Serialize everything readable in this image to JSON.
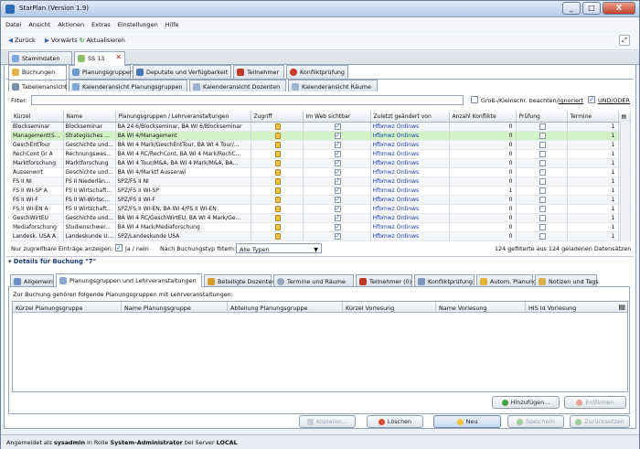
{
  "window": {
    "title": "StarPlan (Version 1.9)",
    "min": "_",
    "max": "□",
    "close": "X"
  },
  "menu": [
    "Datei",
    "Ansicht",
    "Aktionen",
    "Extras",
    "Einstellungen",
    "Hilfe"
  ],
  "nav": {
    "back": "Zurück",
    "forward": "Vorwärts",
    "refresh": "Aktualisieren"
  },
  "doc_tabs": [
    {
      "label": "Stammdaten"
    },
    {
      "label": "SS 13"
    }
  ],
  "main_tabs": [
    "Buchungen",
    "Planungsgruppen",
    "Deputate und Verfügbarkeit",
    "Teilnehmer",
    "Konfliktprüfung"
  ],
  "view_tabs": [
    "Tabellenansicht",
    "Kalenderansicht Planungsgruppen",
    "Kalenderansicht Dozenten",
    "Kalenderansicht Räume"
  ],
  "filter": {
    "label": "Filter:",
    "value": "",
    "case_label": "Groß-/Kleinschr. beachten",
    "ignore_label": "ignoriert",
    "andor_label": "UND/ODER"
  },
  "grid": {
    "columns": [
      "Kürzel",
      "Name",
      "Planungsgruppen / Lehrveranstaltungen",
      "Zugriff",
      "Im Web sichtbar",
      "Zuletzt geändert von",
      "Anzahl Konflikte",
      "Prüfung",
      "Termine"
    ],
    "rows": [
      {
        "k": "Blockseminar",
        "n": "Blockseminar",
        "pg": "BA 24 6/Blockseminar, BA WI 6/Blockseminar",
        "web": true,
        "by": "Hfbmwz Ordinws",
        "konf": "0",
        "pr": false,
        "t": "1"
      },
      {
        "k": "Management(S...",
        "n": "Strategisches ...",
        "pg": "BA WI 4/Management",
        "web": true,
        "by": "Hfbmwz Ordinws",
        "konf": "0",
        "pr": false,
        "t": "1"
      },
      {
        "k": "GeschEntTour",
        "n": "Geschichte und...",
        "pg": "BA WI 4 Mark/GeschEntTour, BA WI 4 Tour/...",
        "web": true,
        "by": "Hfbmwz Ordinws",
        "konf": "0",
        "pr": false,
        "t": "1"
      },
      {
        "k": "RechCont Gr A",
        "n": "Rechnungswes...",
        "pg": "BA WI 4 RC/RechCont, BA WI 4 Mark/RechC...",
        "web": true,
        "by": "Hfbmwz Ordinws",
        "konf": "0",
        "pr": false,
        "t": "1"
      },
      {
        "k": "Marktforschung",
        "n": "Marktforschung",
        "pg": "BA WI 4 Tour/M&A, BA WI 4 Mark/M&A, BA...",
        "web": true,
        "by": "Hfbmwz Ordinws",
        "konf": "0",
        "pr": false,
        "t": "1"
      },
      {
        "k": "Aussenwirt",
        "n": "Geschichte und...",
        "pg": "BA WI 4/Marktf Aussenwi",
        "web": true,
        "by": "Hfbmwz Ordinws",
        "konf": "0",
        "pr": false,
        "t": "1"
      },
      {
        "k": "FS II NI",
        "n": "FS II Niederlän...",
        "pg": "SPZ/FS II NI",
        "web": true,
        "by": "Hfbmwz Ordinws",
        "konf": "0",
        "pr": false,
        "t": "1"
      },
      {
        "k": "FS II WI-SP A",
        "n": "FS II Wirtschaft...",
        "pg": "SPZ/FS II WI-SP",
        "web": true,
        "by": "Hfbmwz Ordinws",
        "konf": "1",
        "pr": false,
        "t": "1"
      },
      {
        "k": "FS II WI-F",
        "n": "FS II WI-Wirtsc...",
        "pg": "SPZ/FS II WI-F",
        "web": true,
        "by": "Hfbmwz Ordinws",
        "konf": "0",
        "pr": false,
        "t": "1"
      },
      {
        "k": "FS II WI-EN A",
        "n": "FS II Wirtschaft...",
        "pg": "SPZ/FS II WI-EN, BA WI 4/FS II WI-EN",
        "web": true,
        "by": "Hfbmwz Ordinws",
        "konf": "0",
        "pr": false,
        "t": "1"
      },
      {
        "k": "GeschWirtEU",
        "n": "Geschichte und...",
        "pg": "BA WI 4 RC/GeschWirtEU, BA WI 4 Mark/Ge...",
        "web": true,
        "by": "Hfbmwz Ordinws",
        "konf": "0",
        "pr": false,
        "t": "1"
      },
      {
        "k": "Mediaforschung",
        "n": "Studienschwer...",
        "pg": "BA WI 4 Mark/Mediaforschung",
        "web": true,
        "by": "Hfbmwz Ordinws",
        "konf": "0",
        "pr": false,
        "t": "1"
      },
      {
        "k": "Landesk. USA A",
        "n": "Landeskunde U...",
        "pg": "SPZ/Landeskunde USA",
        "web": true,
        "by": "Hfbmwz Ordinws",
        "konf": "0",
        "pr": false,
        "t": "1"
      }
    ]
  },
  "bottom": {
    "only_access_label": "Nur zugreifbare Einträge anzeigen:",
    "only_access_value": "ja / nein",
    "type_filter_label": "Nach Buchungstyp filtern:",
    "type_filter_value": "Alle Typen",
    "count_text": "124 gefilterte aus 124 geladenen Datensätzen"
  },
  "details": {
    "header": "Details für Buchung \"7\"",
    "tabs": [
      "Allgemein",
      "Planungsgruppen und Lehrveranstaltungen",
      "Beteiligte Dozenten",
      "Termine und Räume",
      "Teilnehmer (0)",
      "Konfliktprüfung",
      "Autom. Planung",
      "Notizen und Tags"
    ],
    "intro": "Zur Buchung gehören folgende Planungsgruppen mit Lehrveranstaltungen:",
    "columns": [
      "Kürzel Planungsgruppe",
      "Name Planungsgruppe",
      "Abteilung Planungsgruppe",
      "Kürzel Vorlesung",
      "Name Vorlesung",
      "HIS Id Vorlesung"
    ],
    "add_btn": "Hinzufügen...",
    "remove_btn": "Entfernen"
  },
  "actions": {
    "copy": "Kopieren...",
    "delete": "Löschen",
    "new": "Neu",
    "save": "Speichern",
    "reset": "Zurücksetzen"
  },
  "status": {
    "prefix": "Angemeldet als",
    "user": "sysadmin",
    "mid": "in Rolle",
    "role": "System-Administrator",
    "mid2": "bei Server",
    "server": "LOCAL"
  }
}
